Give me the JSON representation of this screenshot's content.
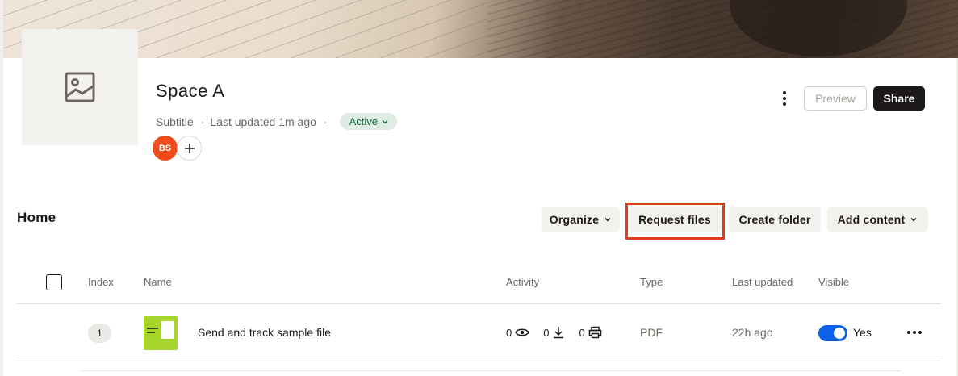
{
  "space": {
    "title": "Space A",
    "subtitle": "Subtitle",
    "last_updated": "Last updated 1m ago",
    "status": "Active",
    "avatar_initials": "BS"
  },
  "header_actions": {
    "preview_label": "Preview",
    "share_label": "Share"
  },
  "section": {
    "title": "Home"
  },
  "toolbar": {
    "organize_label": "Organize",
    "request_files_label": "Request files",
    "create_folder_label": "Create folder",
    "add_content_label": "Add content"
  },
  "table": {
    "columns": [
      "Index",
      "Name",
      "Activity",
      "Type",
      "Last updated",
      "Visible"
    ],
    "rows": [
      {
        "index": "1",
        "name": "Send and track sample file",
        "views": "0",
        "downloads": "0",
        "prints": "0",
        "type": "PDF",
        "last_updated": "22h ago",
        "visible": "Yes"
      }
    ]
  },
  "colors": {
    "accent": "#0b62e8",
    "avatar": "#f04b1a",
    "highlight": "#e23b1a",
    "status_bg": "#dfece4"
  },
  "icons": [
    "image-placeholder-icon",
    "plus-icon",
    "more-vertical-icon",
    "chevron-down-icon",
    "eye-icon",
    "download-icon",
    "print-icon",
    "more-horizontal-icon"
  ]
}
